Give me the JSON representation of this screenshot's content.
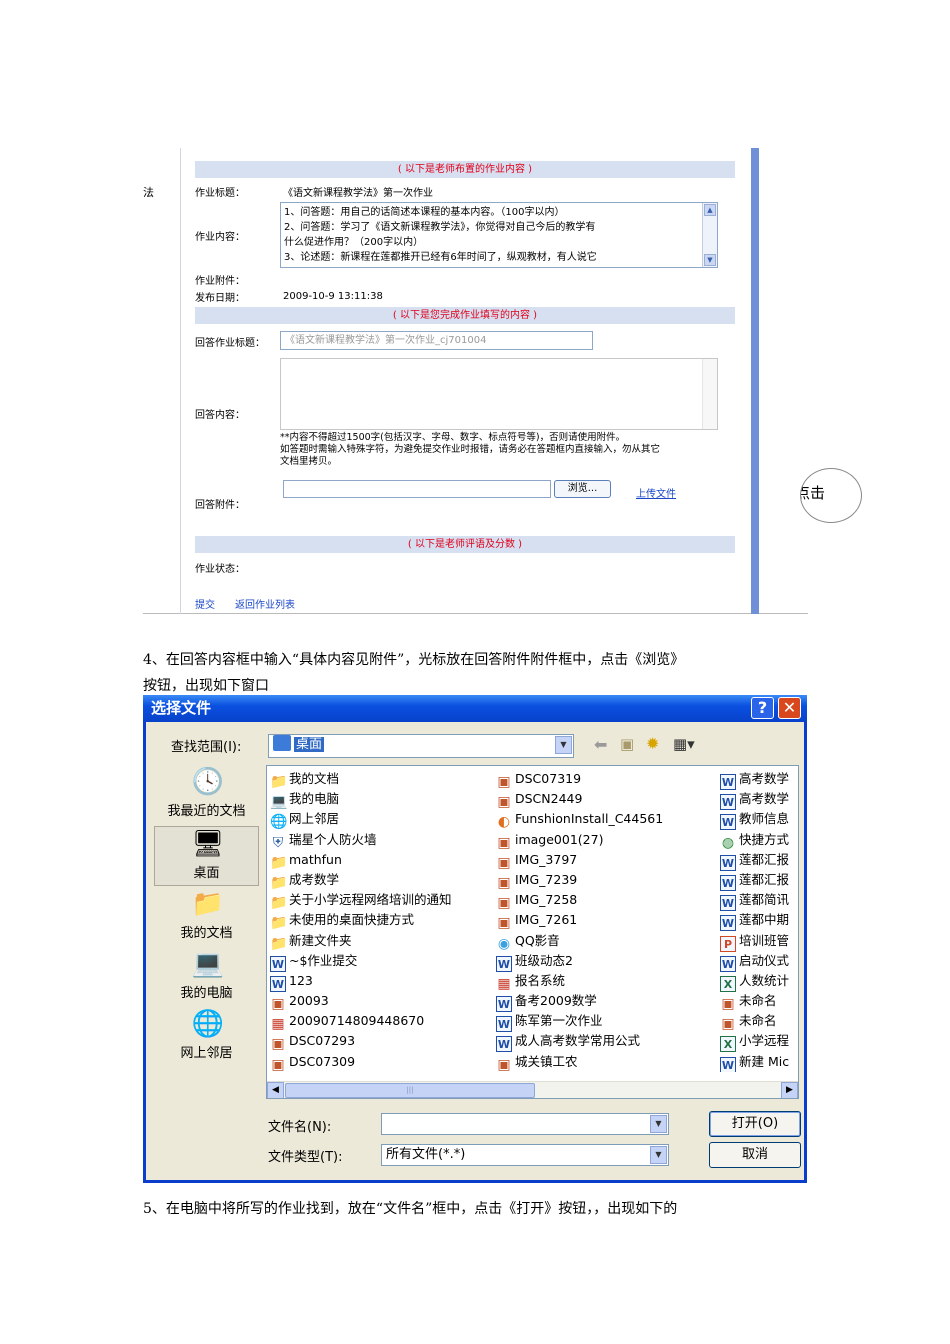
{
  "web": {
    "leftnav_text": "法",
    "banner_assigned": "( 以下是老师布置的作业内容 )",
    "label_title": "作业标题：",
    "hw_title": "《语文新课程教学法》第一次作业",
    "label_content": "作业内容：",
    "hw_content": [
      "1、问答题：用自己的话简述本课程的基本内容。（100字以内）",
      "2、问答题：学习了《语文新课程教学法》，你觉得对自己今后的教学有",
      "什么促进作用？（200字以内）",
      "3、论述题：新课程在莲都推开已经有6年时间了，纵观教材，有人说它"
    ],
    "label_attachment": "作业附件：",
    "label_publish_date": "发布日期：",
    "publish_date": "2009-10-9 13:11:38",
    "banner_answer": "( 以下是您完成作业填写的内容 )",
    "label_answer_title": "回答作业标题：",
    "answer_title_value": "《语文新课程教学法》第一次作业_cj701004",
    "label_answer_content": "回答内容：",
    "note_lines": [
      "**内容不得超过1500字(包括汉字、字母、数字、标点符号等)，否则请使用附件。",
      "如答题时需输入特殊字符，为避免提交作业时报错，请务必在答题框内直接输入，勿从其它",
      "文档里拷贝。"
    ],
    "browse_label": "浏览...",
    "upload_label": "上传文件",
    "label_answer_attachment": "回答附件：",
    "banner_review": "( 以下是老师评语及分数 )",
    "label_status": "作业状态：",
    "submit_label": "提交",
    "back_label": "返回作业列表"
  },
  "callout_text": "点击",
  "step4_lines": [
    "4、在回答内容框中输入“具体内容见附件”，光标放在回答附件附件框中，点击《浏览》",
    "按钮，出现如下窗口"
  ],
  "dialog": {
    "title": "选择文件",
    "help_btn": "?",
    "close_btn": "✕",
    "lookin_label": "查找范围(I):",
    "lookin_value": "桌面",
    "places": [
      "我最近的文档",
      "桌面",
      "我的文档",
      "我的电脑",
      "网上邻居"
    ],
    "columns": [
      [
        {
          "name": "我的文档",
          "icon": "folder-icon"
        },
        {
          "name": "我的电脑",
          "icon": "computer-icon"
        },
        {
          "name": "网上邻居",
          "icon": "network-icon"
        },
        {
          "name": "瑞星个人防火墙",
          "icon": "firewall-icon"
        },
        {
          "name": "mathfun",
          "icon": "folder-icon"
        },
        {
          "name": "成考数学",
          "icon": "folder-icon"
        },
        {
          "name": "关于小学远程网络培训的通知",
          "icon": "folder-icon"
        },
        {
          "name": "未使用的桌面快捷方式",
          "icon": "folder-icon"
        },
        {
          "name": "新建文件夹",
          "icon": "folder-icon"
        },
        {
          "name": "~$作业提交",
          "icon": "word-icon"
        },
        {
          "name": "123",
          "icon": "word-icon"
        },
        {
          "name": "20093",
          "icon": "image-icon"
        },
        {
          "name": "20090714809448670",
          "icon": "app-icon"
        },
        {
          "name": "DSC07293",
          "icon": "image-icon"
        },
        {
          "name": "DSC07309",
          "icon": "image-icon"
        }
      ],
      [
        {
          "name": "DSC07319",
          "icon": "image-icon"
        },
        {
          "name": "DSCN2449",
          "icon": "image-icon"
        },
        {
          "name": "FunshionInstall_C44561",
          "icon": "installer-icon"
        },
        {
          "name": "image001(27)",
          "icon": "image-icon"
        },
        {
          "name": "IMG_3797",
          "icon": "image-icon"
        },
        {
          "name": "IMG_7239",
          "icon": "image-icon"
        },
        {
          "name": "IMG_7258",
          "icon": "image-icon"
        },
        {
          "name": "IMG_7261",
          "icon": "image-icon"
        },
        {
          "name": "QQ影音",
          "icon": "media-player-icon"
        },
        {
          "name": "班级动态2",
          "icon": "word-icon"
        },
        {
          "name": "报名系统",
          "icon": "app-icon"
        },
        {
          "name": "备考2009数学",
          "icon": "word-icon"
        },
        {
          "name": "陈军第一次作业",
          "icon": "word-icon"
        },
        {
          "name": "成人高考数学常用公式",
          "icon": "word-icon"
        },
        {
          "name": "城关镇工农",
          "icon": "image-icon"
        }
      ],
      [
        {
          "name": "高考数学",
          "icon": "word-icon"
        },
        {
          "name": "高考数学",
          "icon": "word-icon"
        },
        {
          "name": "教师信息",
          "icon": "word-icon"
        },
        {
          "name": "快捷方式",
          "icon": "shortcut-icon"
        },
        {
          "name": "莲都汇报",
          "icon": "word-icon"
        },
        {
          "name": "莲都汇报",
          "icon": "word-icon"
        },
        {
          "name": "莲都简讯",
          "icon": "word-icon"
        },
        {
          "name": "莲都中期",
          "icon": "word-icon"
        },
        {
          "name": "培训班管",
          "icon": "powerpoint-icon"
        },
        {
          "name": "启动仪式",
          "icon": "word-icon"
        },
        {
          "name": "人数统计",
          "icon": "excel-icon"
        },
        {
          "name": "未命名",
          "icon": "image-icon"
        },
        {
          "name": "未命名",
          "icon": "image-icon"
        },
        {
          "name": "小学远程",
          "icon": "excel-icon"
        },
        {
          "name": "新建 Mic",
          "icon": "word-icon"
        }
      ]
    ],
    "filename_label": "文件名(N):",
    "filename_value": "",
    "filetype_label": "文件类型(T):",
    "filetype_value": "所有文件(*.*)",
    "open_btn": "打开(O)",
    "cancel_btn": "取消"
  },
  "step5_line": "5、在电脑中将所写的作业找到，放在“文件名”框中，点击《打开》按钮，，出现如下的"
}
